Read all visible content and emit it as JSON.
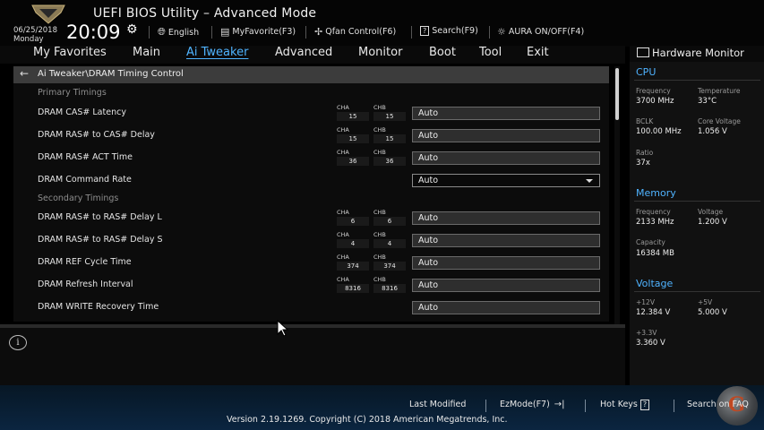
{
  "header": {
    "title": "UEFI BIOS Utility – Advanced Mode",
    "date": "06/25/2018",
    "day": "Monday",
    "time": "20:09",
    "tools": [
      {
        "icon": "globe-icon",
        "label": "English"
      },
      {
        "icon": "favorite-icon",
        "label": "MyFavorite(F3)"
      },
      {
        "icon": "fan-icon",
        "label": "Qfan Control(F6)"
      },
      {
        "icon": "search-icon",
        "label": "Search(F9)"
      },
      {
        "icon": "aura-icon",
        "label": "AURA ON/OFF(F4)"
      }
    ]
  },
  "menu": {
    "items": [
      "My Favorites",
      "Main",
      "Ai Tweaker",
      "Advanced",
      "Monitor",
      "Boot",
      "Tool",
      "Exit"
    ],
    "active": "Ai Tweaker"
  },
  "breadcrumb": "Ai Tweaker\\DRAM Timing Control",
  "sections": {
    "primary": "Primary Timings",
    "secondary": "Secondary Timings"
  },
  "channel_labels": {
    "a": "CHA",
    "b": "CHB"
  },
  "rows": [
    {
      "label": "DRAM CAS# Latency",
      "cha": "15",
      "chb": "15",
      "value": "Auto"
    },
    {
      "label": "DRAM RAS# to CAS# Delay",
      "cha": "15",
      "chb": "15",
      "value": "Auto"
    },
    {
      "label": "DRAM RAS# ACT Time",
      "cha": "36",
      "chb": "36",
      "value": "Auto"
    },
    {
      "label": "DRAM Command Rate",
      "value": "Auto"
    },
    {
      "label": "DRAM RAS# to RAS# Delay L",
      "cha": "6",
      "chb": "6",
      "value": "Auto"
    },
    {
      "label": "DRAM RAS# to RAS# Delay S",
      "cha": "4",
      "chb": "4",
      "value": "Auto"
    },
    {
      "label": "DRAM REF Cycle Time",
      "cha": "374",
      "chb": "374",
      "value": "Auto"
    },
    {
      "label": "DRAM Refresh Interval",
      "cha": "8316",
      "chb": "8316",
      "value": "Auto"
    },
    {
      "label": "DRAM WRITE Recovery Time",
      "value": "Auto"
    }
  ],
  "hardware_monitor": {
    "title": "Hardware Monitor",
    "cpu": {
      "title": "CPU",
      "frequency_label": "Frequency",
      "frequency": "3700 MHz",
      "temperature_label": "Temperature",
      "temperature": "33°C",
      "bclk_label": "BCLK",
      "bclk": "100.00 MHz",
      "core_voltage_label": "Core Voltage",
      "core_voltage": "1.056 V",
      "ratio_label": "Ratio",
      "ratio": "37x"
    },
    "memory": {
      "title": "Memory",
      "frequency_label": "Frequency",
      "frequency": "2133 MHz",
      "voltage_label": "Voltage",
      "voltage": "1.200 V",
      "capacity_label": "Capacity",
      "capacity": "16384 MB"
    },
    "voltage": {
      "title": "Voltage",
      "v12_label": "+12V",
      "v12": "12.384 V",
      "v5_label": "+5V",
      "v5": "5.000 V",
      "v33_label": "+3.3V",
      "v33": "3.360 V"
    }
  },
  "footer": {
    "last_modified": "Last Modified",
    "ezmode": "EzMode(F7)",
    "ezmode_icon": "→|",
    "hotkeys": "Hot Keys",
    "hotkeys_icon": "?",
    "search_faq": "Search on FAQ",
    "version": "Version 2.19.1269. Copyright (C) 2018 American Megatrends, Inc."
  },
  "colors": {
    "accent": "#4fb3ff",
    "background": "#0c0c0c",
    "footer": "#0b2540"
  }
}
